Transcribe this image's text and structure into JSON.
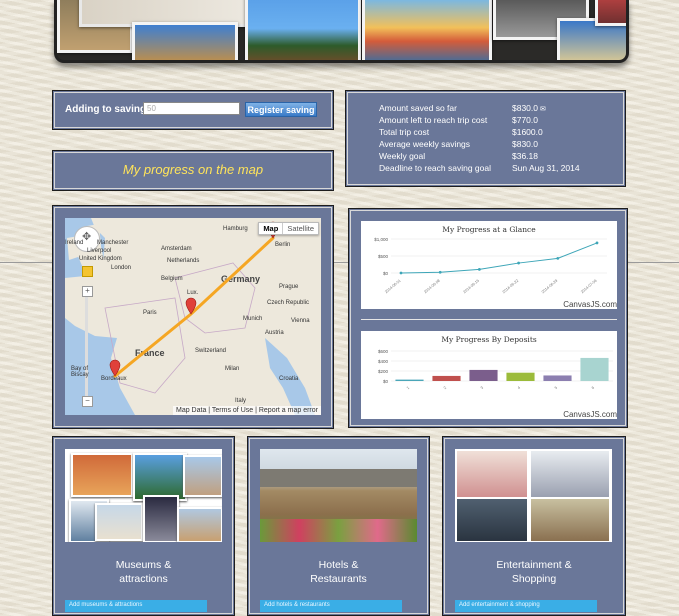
{
  "savings_form": {
    "label": "Adding to savings",
    "input_value": "50",
    "button_label": "Register saving"
  },
  "stats": [
    {
      "label": "Amount saved so far",
      "value": "$830.0"
    },
    {
      "label": "Amount left to reach trip cost",
      "value": "$770.0"
    },
    {
      "label": "Total trip cost",
      "value": "$1600.0"
    },
    {
      "label": "Average weekly savings",
      "value": "$830.0"
    },
    {
      "label": "Weekly goal",
      "value": "$36.18"
    },
    {
      "label": "Deadline to reach saving goal",
      "value": "Sun Aug 31, 2014"
    }
  ],
  "progress_link": "My progress on the map",
  "map": {
    "toggle_map": "Map",
    "toggle_satellite": "Satellite",
    "footer": "Map Data | Terms of Use | Report a map error",
    "labels": {
      "ireland": "Ireland",
      "liverpool": "Liverpool",
      "manchester": "Manchester",
      "united_kingdom": "United Kingdom",
      "london": "London",
      "amsterdam": "Amsterdam",
      "netherlands": "Netherlands",
      "belgium": "Belgium",
      "hamburg": "Hamburg",
      "berlin": "Berlin",
      "germany": "Germany",
      "prague": "Prague",
      "czech_republic": "Czech Republic",
      "munich": "Munich",
      "vienna": "Vienna",
      "austria": "Austria",
      "paris": "Paris",
      "france": "France",
      "switzerland": "Switzerland",
      "milan": "Milan",
      "croatia": "Croatia",
      "bordeaux": "Bordeaux",
      "bay_of_biscay": "Bay of Biscay",
      "italy": "Italy",
      "lux": "Lux."
    }
  },
  "charts": {
    "credit": "CanvasJS.com"
  },
  "chart_data": [
    {
      "type": "line",
      "title": "My Progress at a Glance",
      "x": [
        "2014-06-01",
        "2014-06-08",
        "2014-06-15",
        "2014-06-22",
        "2014-06-29",
        "2014-07-06"
      ],
      "values": [
        0,
        30,
        140,
        380,
        560,
        1150
      ],
      "y_ticks": [
        "$1,000",
        "$500",
        "$0"
      ],
      "ylim": [
        0,
        1300
      ],
      "color": "#3ea6b8"
    },
    {
      "type": "bar",
      "title": "My  Progress By Deposits",
      "categories": [
        "1",
        "2",
        "3",
        "4",
        "5",
        "6"
      ],
      "values": [
        30,
        110,
        240,
        180,
        120,
        500
      ],
      "y_ticks": [
        "$600",
        "$400",
        "$200",
        "$0"
      ],
      "ylim": [
        0,
        650
      ],
      "colors": [
        "#4aa6b8",
        "#c0504d",
        "#7b5e8c",
        "#9bbb3a",
        "#8c7fb0",
        "#a8d4d0"
      ]
    }
  ],
  "categories": [
    {
      "label_line1": "Museums &",
      "label_line2": "attractions",
      "button": "Add museums & attractions"
    },
    {
      "label_line1": "Hotels &",
      "label_line2": "Restaurants",
      "button": "Add hotels & restaurants"
    },
    {
      "label_line1": "Entertainment &",
      "label_line2": "Shopping",
      "button": "Add entertainment & shopping"
    }
  ]
}
